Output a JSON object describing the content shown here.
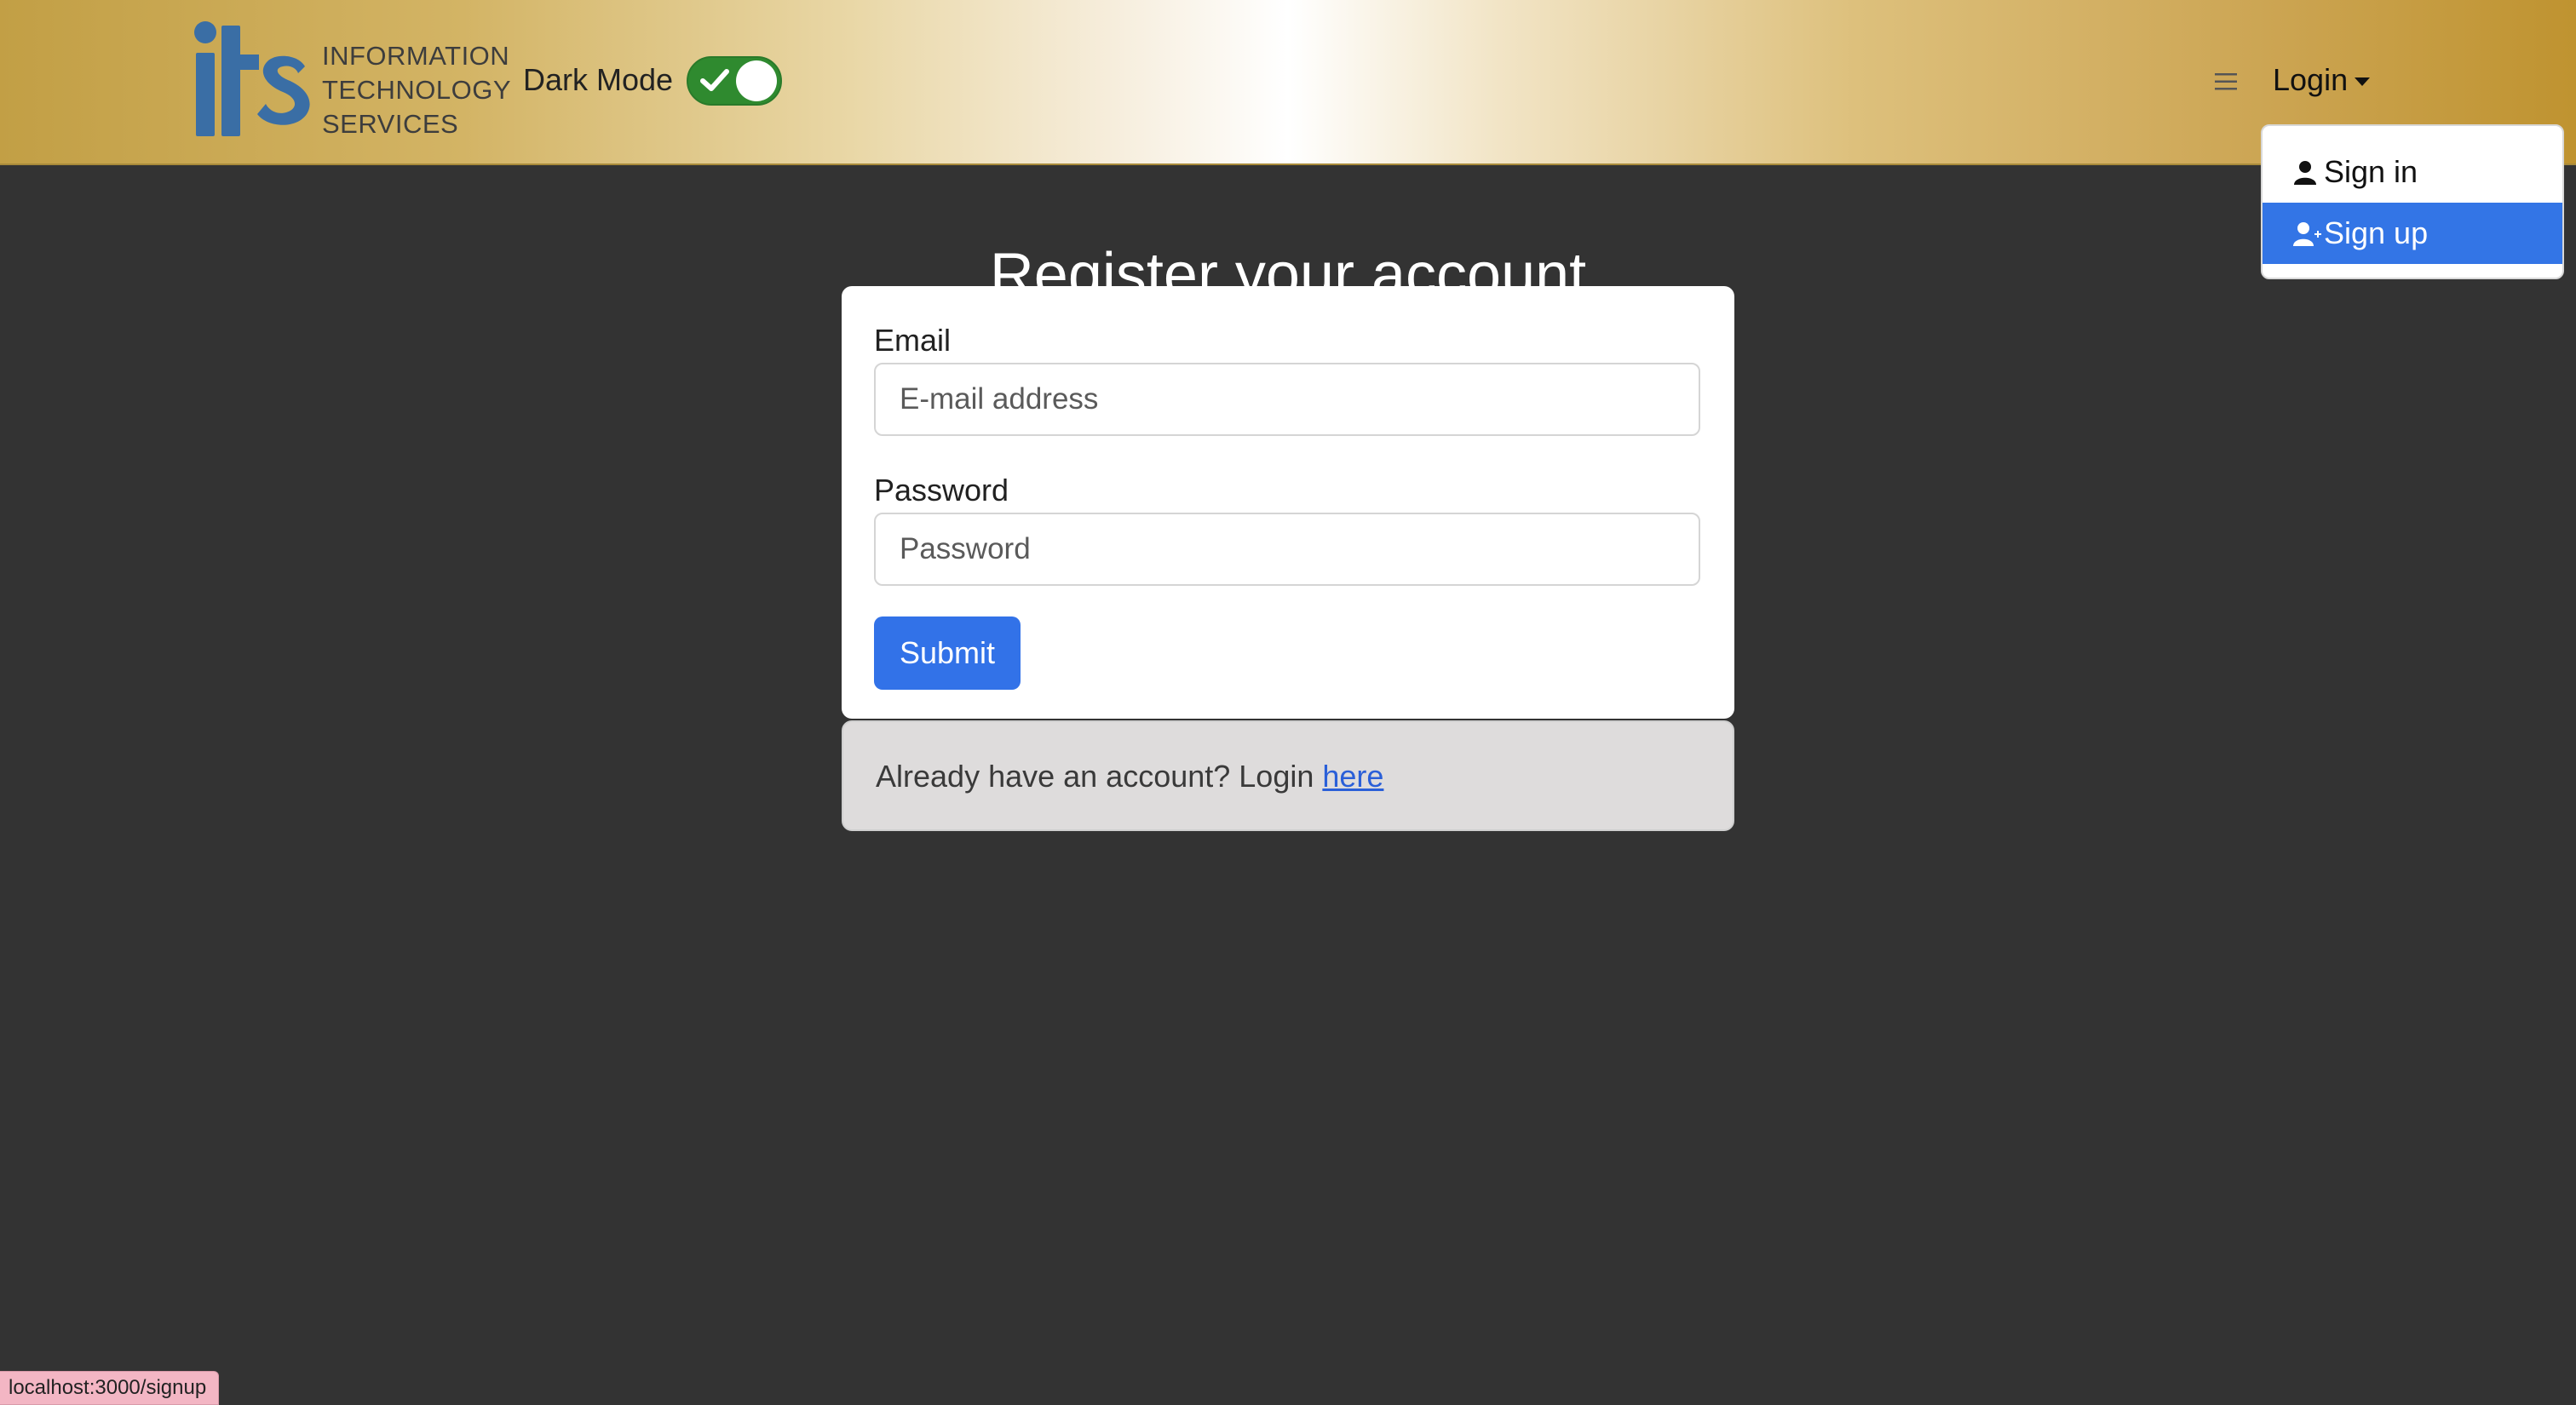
{
  "navbar": {
    "logo_mark": "its",
    "logo_lines": [
      "INFORMATION",
      "TECHNOLOGY",
      "SERVICES"
    ],
    "dark_mode_label": "Dark Mode",
    "dark_mode_on": true,
    "menu_icon": "hamburger-icon",
    "login_label": "Login",
    "dropdown": [
      {
        "label": "Sign in",
        "icon": "person-icon",
        "active": false
      },
      {
        "label": "Sign up",
        "icon": "person-plus-icon",
        "active": true
      }
    ]
  },
  "main": {
    "title": "Register your account",
    "email_label": "Email",
    "email_placeholder": "E-mail address",
    "password_label": "Password",
    "password_placeholder": "Password",
    "submit_label": "Submit",
    "footer_text": "Already have an account? Login ",
    "footer_link": "here"
  },
  "status_bar": {
    "url": "localhost:3000/signup"
  },
  "colors": {
    "background": "#333333",
    "primary": "#3272e8",
    "toggle_on": "#2f8a2f",
    "status_bar": "#f3b6c4"
  }
}
